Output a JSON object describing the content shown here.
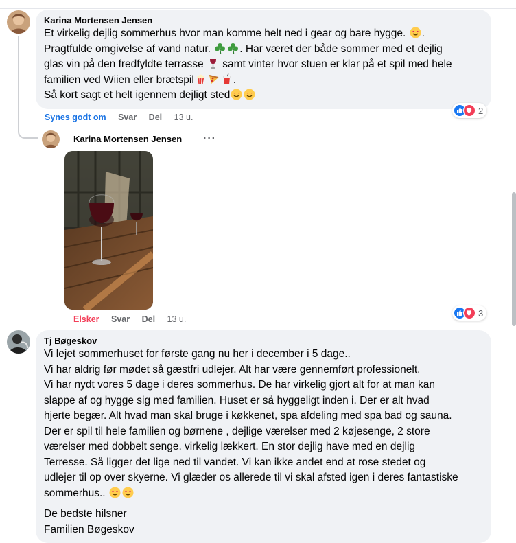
{
  "comments": [
    {
      "author": "Karina Mortensen Jensen",
      "lines": [
        "Et virkelig dejlig sommerhus hvor man komme helt ned i gear og bare hygge.",
        "Pragtfulde omgivelse af vand natur.",
        ". Har været der både sommer med et dejlig",
        "glas vin på den fredfyldte terrasse",
        "samt vinter hvor stuen er klar på et spil med hele",
        "familien ved Wiien eller brætspil",
        "Så kort sagt et helt igennem dejligt sted"
      ],
      "actions": {
        "like": "Synes godt om",
        "reply": "Svar",
        "share": "Del",
        "time": "13 u."
      },
      "reaction_count": "2"
    },
    {
      "author": "Karina Mortensen Jensen",
      "more": "···",
      "actions": {
        "like": "Elsker",
        "reply": "Svar",
        "share": "Del",
        "time": "13 u."
      },
      "reaction_count": "3"
    },
    {
      "author": "Tj Bøgeskov",
      "lines": [
        "Vi lejet sommerhuset for første gang nu her i december i 5 dage..",
        "Vi har aldrig før mødet så gæstfri udlejer. Alt har være gennemført professionelt.",
        "Vi har nydt vores 5 dage i deres sommerhus. De har virkelig gjort alt for at man kan",
        "slappe af og hygge sig med familien. Huset er så hyggeligt inden i. Der er alt hvad",
        "hjerte begær. Alt hvad man skal bruge i køkkenet, spa afdeling med spa bad og sauna.",
        "Der er spil til hele familien og børnene , dejlige værelser med 2 køjesenge, 2 store",
        "værelser med dobbelt senge. virkelig lækkert. En stor dejlig have med en dejlig",
        "Terresse. Så ligger det lige ned til vandet. Vi kan ikke andet end at rose stedet og",
        "udlejer til op over skyerne. Vi glæder os allerede til vi skal afsted igen i deres fantastiske",
        "sommerhus.."
      ],
      "signoff": [
        "De bedste hilsner",
        "Familien Bøgeskov"
      ]
    }
  ],
  "colors": {
    "bubble": "#f0f2f5",
    "like_blue": "#1b74e4",
    "love_red": "#f33e58",
    "meta_gray": "#65676b"
  }
}
